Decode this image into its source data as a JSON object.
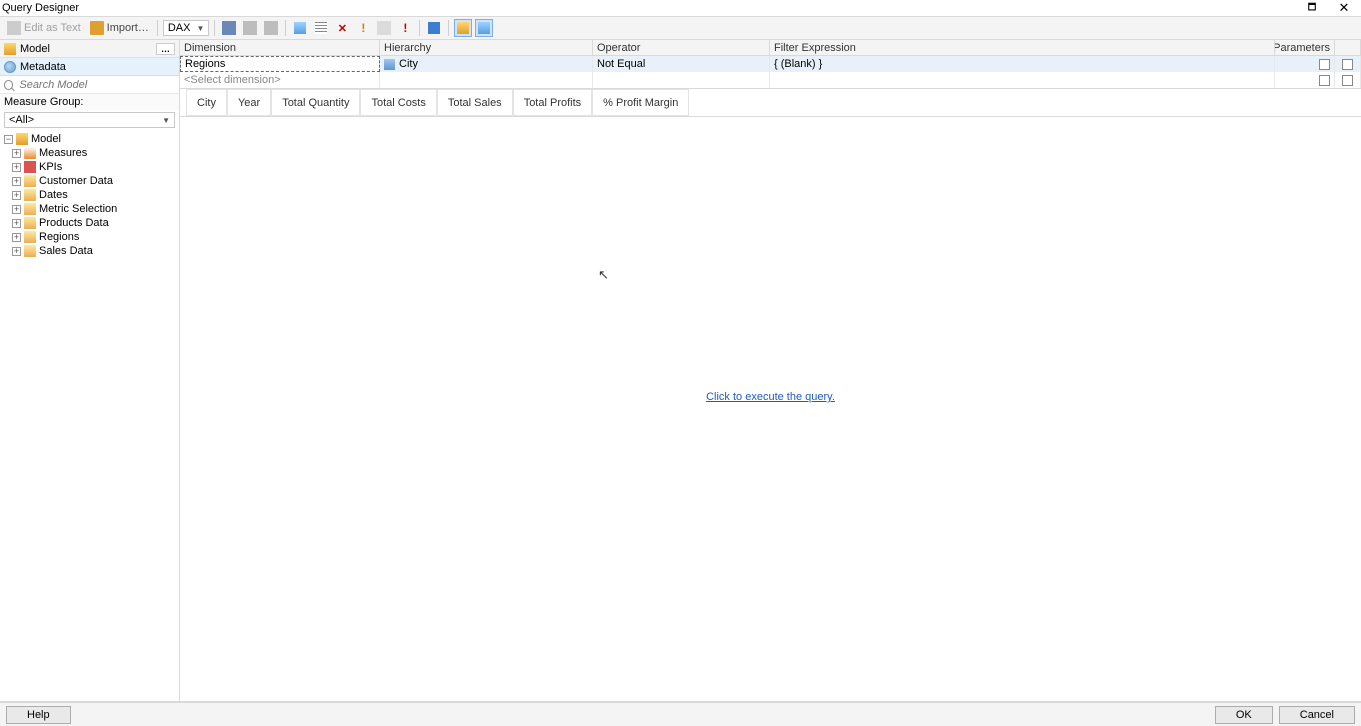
{
  "title": "Query Designer",
  "toolbar": {
    "editAsText": "Edit as Text",
    "import": "Import…",
    "language": "DAX"
  },
  "leftPanel": {
    "modelHeader": "Model",
    "metadata": "Metadata",
    "searchPlaceholder": "Search Model",
    "measureGroupLabel": "Measure Group:",
    "measureGroupAll": "<All>",
    "rootNode": "Model",
    "children": [
      "Measures",
      "KPIs",
      "Customer Data",
      "Dates",
      "Metric Selection",
      "Products Data",
      "Regions",
      "Sales Data"
    ]
  },
  "filterGrid": {
    "headers": {
      "dimension": "Dimension",
      "hierarchy": "Hierarchy",
      "operator": "Operator",
      "filterExpr": "Filter Expression",
      "parameters": "Parameters"
    },
    "rows": [
      {
        "dimension": "Regions",
        "hierarchy": "City",
        "operator": "Not Equal",
        "filterExpr": "{ (Blank) }"
      }
    ],
    "placeholder": "<Select dimension>"
  },
  "columns": [
    "City",
    "Year",
    "Total Quantity",
    "Total Costs",
    "Total Sales",
    "Total Profits",
    "% Profit Margin"
  ],
  "executeLink": "Click to execute the query.",
  "bottom": {
    "help": "Help",
    "ok": "OK",
    "cancel": "Cancel"
  }
}
